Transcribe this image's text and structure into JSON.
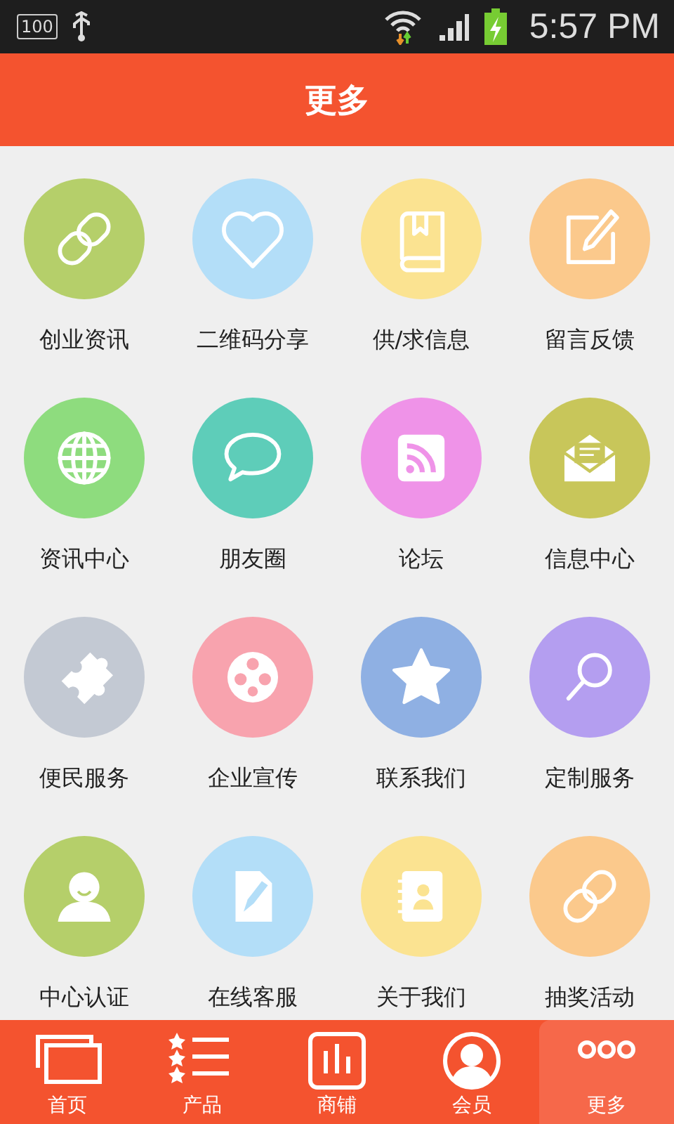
{
  "status_bar": {
    "battery_text": "100",
    "time": "5:57 PM"
  },
  "header": {
    "title": "更多"
  },
  "grid": [
    {
      "label": "创业资讯",
      "color": "#b5cf6a",
      "kind": "link"
    },
    {
      "label": "二维码分享",
      "color": "#b3def8",
      "kind": "heart"
    },
    {
      "label": "供/求信息",
      "color": "#fbe391",
      "kind": "book"
    },
    {
      "label": "留言反馈",
      "color": "#fbc98c",
      "kind": "edit"
    },
    {
      "label": "资讯中心",
      "color": "#8edc7e",
      "kind": "globe"
    },
    {
      "label": "朋友圈",
      "color": "#5ecdb9",
      "kind": "chat"
    },
    {
      "label": "论坛",
      "color": "#ef93e8",
      "kind": "rss"
    },
    {
      "label": "信息中心",
      "color": "#c8c65a",
      "kind": "mail"
    },
    {
      "label": "便民服务",
      "color": "#c3c9d3",
      "kind": "puzzle"
    },
    {
      "label": "企业宣传",
      "color": "#f8a3ae",
      "kind": "film"
    },
    {
      "label": "联系我们",
      "color": "#8fb0e3",
      "kind": "star"
    },
    {
      "label": "定制服务",
      "color": "#b49ef0",
      "kind": "search"
    },
    {
      "label": "中心认证",
      "color": "#b5cf6a",
      "kind": "person"
    },
    {
      "label": "在线客服",
      "color": "#b3def8",
      "kind": "doc"
    },
    {
      "label": "关于我们",
      "color": "#fbe391",
      "kind": "contacts"
    },
    {
      "label": "抽奖活动",
      "color": "#fbc98c",
      "kind": "link"
    }
  ],
  "tab_bar": [
    {
      "label": "首页",
      "kind": "pages",
      "selected": false
    },
    {
      "label": "产品",
      "kind": "list",
      "selected": false
    },
    {
      "label": "商铺",
      "kind": "chart",
      "selected": false
    },
    {
      "label": "会员",
      "kind": "user",
      "selected": false
    },
    {
      "label": "更多",
      "kind": "dots",
      "selected": true
    }
  ]
}
